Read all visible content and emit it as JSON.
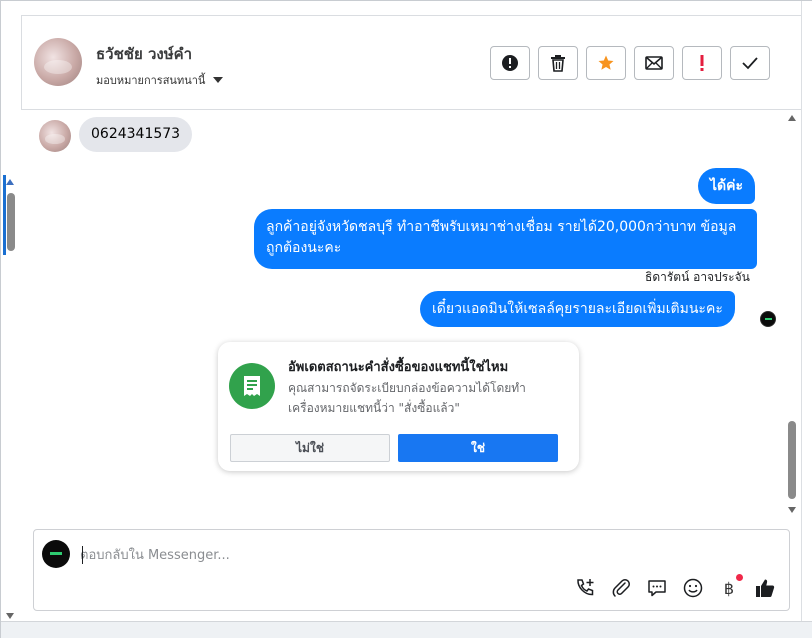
{
  "header": {
    "contact_name": "ธวัชชัย วงษ์คำ",
    "assign_label": "มอบหมายการสนทนานี้",
    "toolbar": [
      {
        "name": "spam-button",
        "icon": "exclamation-circle-icon"
      },
      {
        "name": "delete-button",
        "icon": "trash-icon"
      },
      {
        "name": "star-button",
        "icon": "star-icon",
        "color": "#f7931e"
      },
      {
        "name": "unread-button",
        "icon": "envelope-icon"
      },
      {
        "name": "follow-up-button",
        "icon": "exclamation-icon",
        "color": "#e41e3f"
      },
      {
        "name": "done-button",
        "icon": "check-icon"
      }
    ]
  },
  "thread": {
    "incoming": [
      {
        "text": "0624341573"
      }
    ],
    "outgoing": [
      {
        "text": "ได้ค่ะ"
      },
      {
        "text": "ลูกค้าอยู่จังหวัดชลบุรี ทำอาชีพรับเหมาช่างเชื่อม รายได้20,000กว่าบาท ข้อมูลถูกต้องนะคะ"
      },
      {
        "text": "เดี๋ยวแอดมินให้เซลล์คุยรายละเอียดเพิ่มเติมนะคะ"
      }
    ],
    "sender_name": "ธิดารัตน์ อาจประจัน"
  },
  "order_prompt": {
    "title": "อัพเดตสถานะคำสั่งซื้อของแชทนี้ใช่ไหม",
    "description": "คุณสามารถจัดระเบียบกล่องข้อความได้โดยทำเครื่องหมายแชทนี้ว่า \"สั่งซื้อแล้ว\"",
    "no_label": "ไม่ใช่",
    "yes_label": "ใช่",
    "icon": "receipt-icon",
    "icon_color": "#31a24c"
  },
  "composer": {
    "placeholder": "ตอบกลับใน Messenger...",
    "tools": [
      "call-add-icon",
      "attachment-icon",
      "saved-reply-icon",
      "emoji-icon",
      "baht-payment-icon",
      "thumbs-up-icon"
    ],
    "baht_symbol": "฿"
  },
  "colors": {
    "accent": "#0a7cff",
    "incoming_bubble": "#e4e6eb",
    "yes_button": "#1877f2"
  }
}
